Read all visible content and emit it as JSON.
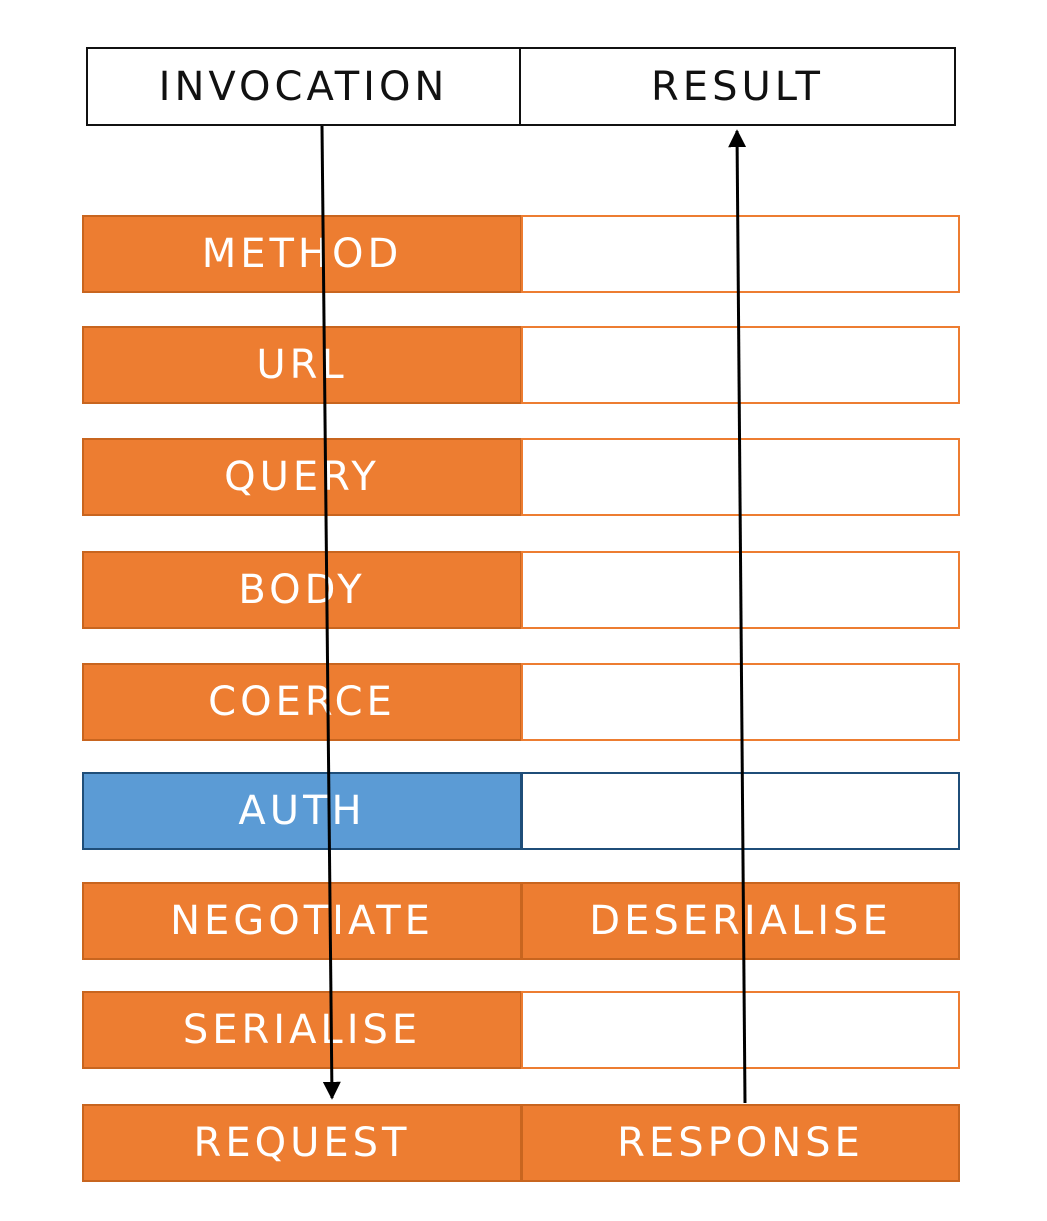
{
  "colors": {
    "stage_fill": "#ED7D31",
    "stage_border": "#C8651F",
    "auth_fill": "#5B9BD5",
    "auth_border": "#1F4E79",
    "arrow": "#000000"
  },
  "header": {
    "left_label": "INVOCATION",
    "right_label": "RESULT"
  },
  "stages": [
    {
      "left": "METHOD",
      "right": "",
      "style": "orange"
    },
    {
      "left": "URL",
      "right": "",
      "style": "orange"
    },
    {
      "left": "QUERY",
      "right": "",
      "style": "orange"
    },
    {
      "left": "BODY",
      "right": "",
      "style": "orange"
    },
    {
      "left": "COERCE",
      "right": "",
      "style": "orange"
    },
    {
      "left": "AUTH",
      "right": "",
      "style": "blue"
    },
    {
      "left": "NEGOTIATE",
      "right": "DESERIALISE",
      "style": "orange"
    },
    {
      "left": "SERIALISE",
      "right": "",
      "style": "orange"
    },
    {
      "left": "REQUEST",
      "right": "RESPONSE",
      "style": "orange"
    }
  ]
}
